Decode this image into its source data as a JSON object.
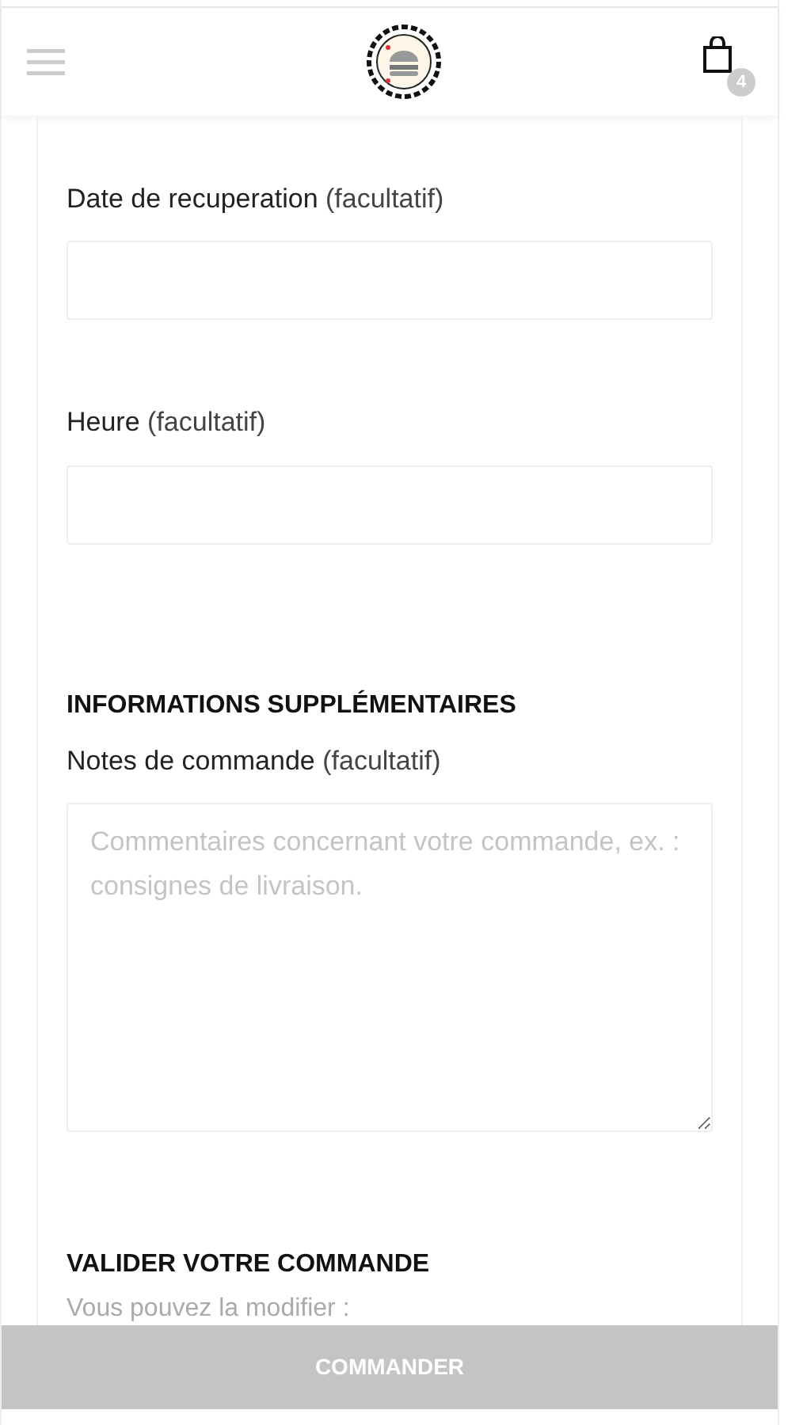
{
  "header": {
    "cart_count": "4"
  },
  "fields": [
    {
      "label": "Date de recuperation",
      "optional": "(facultatif)"
    },
    {
      "label": "Heure",
      "optional": "(facultatif)"
    }
  ],
  "additional_info": {
    "heading": "INFORMATIONS SUPPLÉMENTAIRES",
    "label": "Notes de commande",
    "optional": "(facultatif)",
    "placeholder": "Commentaires concernant votre commande, ex. : consignes de livraison."
  },
  "validation": {
    "heading": "VALIDER VOTRE COMMANDE",
    "text": "Vous pouvez la modifier :"
  },
  "order_button": {
    "label": "COMMANDER",
    "disabled": true
  }
}
